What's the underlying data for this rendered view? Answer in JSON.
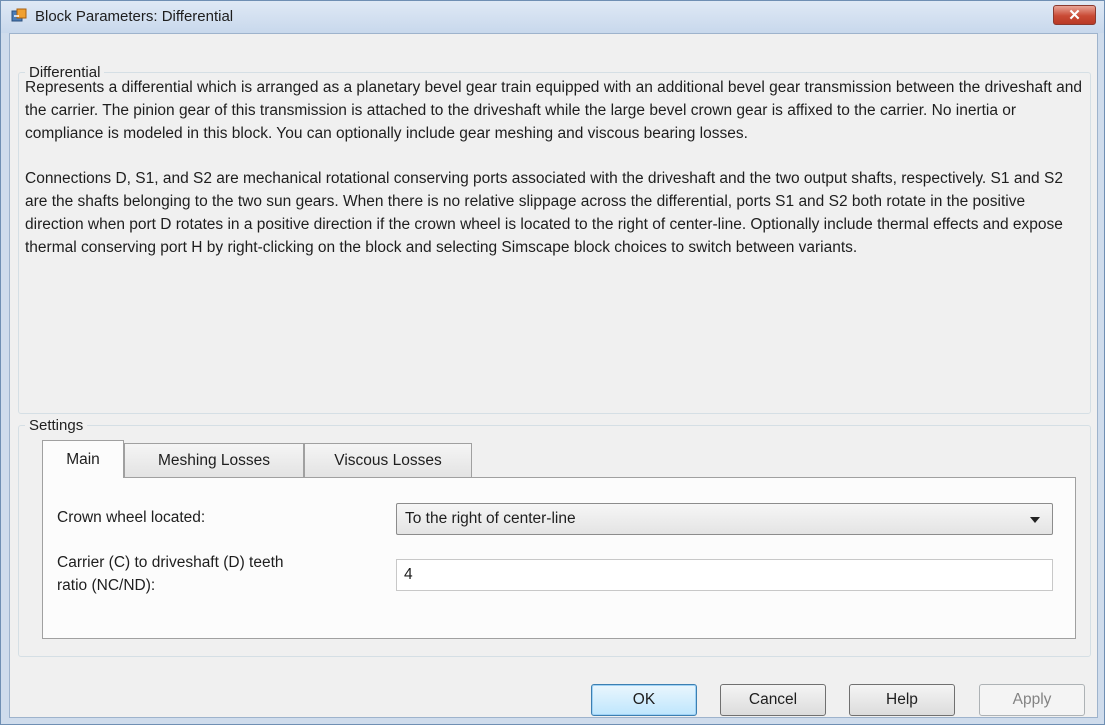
{
  "window": {
    "title": "Block Parameters: Differential",
    "close_label": "✕"
  },
  "description_group": {
    "legend": "Differential",
    "paragraphs": [
      "Represents a differential which is arranged as a planetary bevel gear train equipped with an additional bevel gear transmission between the driveshaft and the carrier. The pinion gear of this transmission is attached to the driveshaft while the large bevel crown gear is affixed to the carrier. No inertia or compliance is modeled in this block. You can optionally include gear meshing and viscous bearing losses.",
      "Connections D, S1, and S2 are mechanical rotational conserving ports associated with the driveshaft and the two output shafts, respectively. S1 and S2 are the shafts belonging to the two sun gears. When there is no relative slippage across the differential, ports S1 and S2 both rotate in the positive direction when port D rotates in a positive direction if the crown wheel is located to the right of center-line. Optionally include thermal effects and expose thermal conserving port H by right-clicking on the block and selecting Simscape block choices to switch between variants."
    ]
  },
  "settings_group": {
    "legend": "Settings",
    "tabs": [
      {
        "label": "Main"
      },
      {
        "label": "Meshing Losses"
      },
      {
        "label": "Viscous Losses"
      }
    ],
    "active_tab": "Main",
    "main": {
      "crown_label": "Crown wheel located:",
      "crown_value": "To the right of center-line",
      "ratio_label_line1": "Carrier (C) to driveshaft (D) teeth",
      "ratio_label_line2": "ratio (NC/ND):",
      "ratio_value": "4"
    }
  },
  "buttons": {
    "ok": "OK",
    "cancel": "Cancel",
    "help": "Help",
    "apply": "Apply"
  }
}
